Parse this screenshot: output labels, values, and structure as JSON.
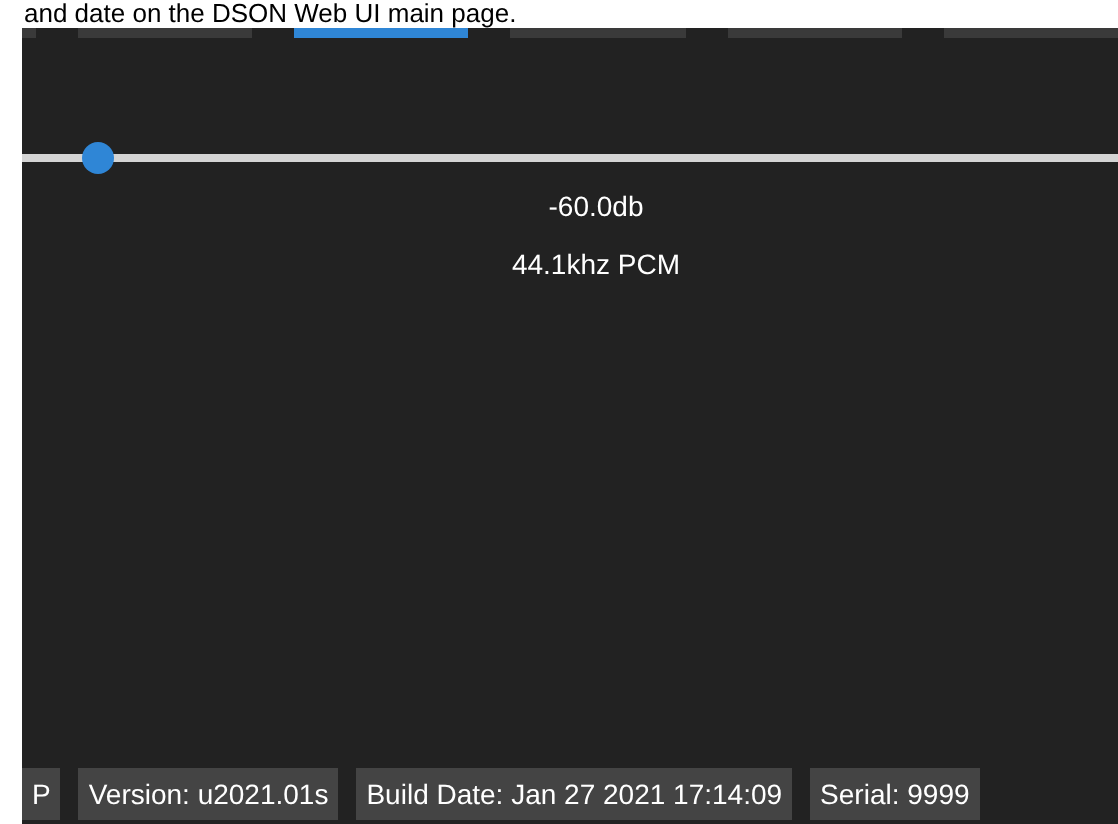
{
  "heading": "and date on the DSON Web UI main page.",
  "tabs": [
    {
      "selected": false
    },
    {
      "selected": false
    },
    {
      "selected": true
    },
    {
      "selected": false
    },
    {
      "selected": false
    },
    {
      "selected": false
    }
  ],
  "volume": {
    "level": 0.07,
    "reading": "-60.0db",
    "format": "44.1khz PCM"
  },
  "status_bar": [
    "P",
    "Version: u2021.01s",
    "Build Date: Jan 27 2021 17:14:09",
    "Serial: 9999"
  ]
}
